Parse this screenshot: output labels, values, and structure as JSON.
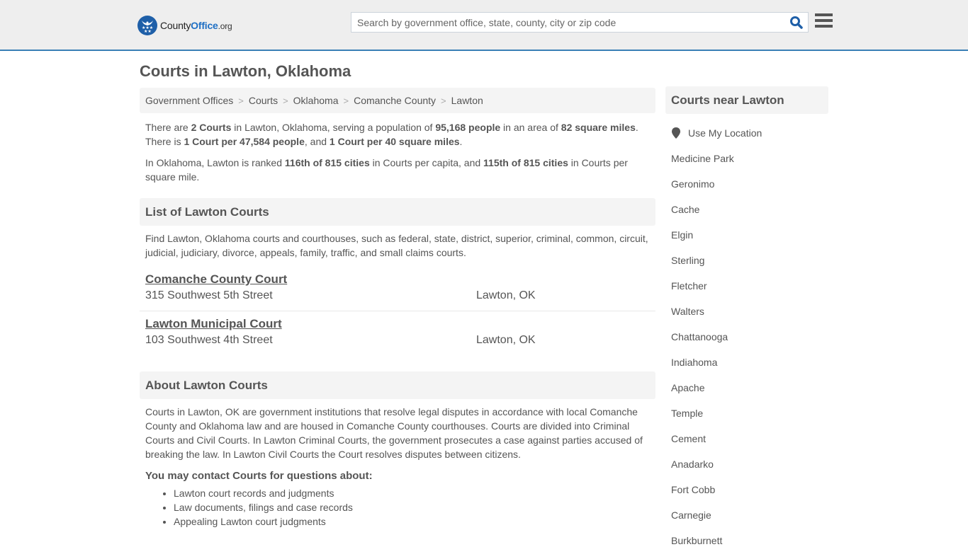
{
  "header": {
    "logo": {
      "name_part1": "County",
      "name_part2": "Office",
      "tld": ".org"
    },
    "search": {
      "placeholder": "Search by government office, state, county, city or zip code",
      "value": ""
    },
    "icons": {
      "search": "search-icon",
      "menu": "hamburger-menu-icon",
      "logo": "eagle-stars-badge-icon"
    },
    "accent_color": "#3a7fb5"
  },
  "page_title": "Courts in Lawton, Oklahoma",
  "breadcrumb": [
    "Government Offices",
    "Courts",
    "Oklahoma",
    "Comanche County",
    "Lawton"
  ],
  "intro": {
    "p1": {
      "t1": "There are ",
      "b1": "2 Courts",
      "t2": " in Lawton, Oklahoma, serving a population of ",
      "b2": "95,168 people",
      "t3": " in an area of ",
      "b3": "82 square miles",
      "t4": ". There is ",
      "b4": "1 Court per 47,584 people",
      "t5": ", and ",
      "b5": "1 Court per 40 square miles",
      "t6": "."
    },
    "p2": {
      "t1": "In Oklahoma, Lawton is ranked ",
      "b1": "116th of 815 cities",
      "t2": " in Courts per capita, and ",
      "b2": "115th of 815 cities",
      "t3": " in Courts per square mile."
    }
  },
  "list_section": {
    "title": "List of Lawton Courts",
    "description": "Find Lawton, Oklahoma courts and courthouses, such as federal, state, district, superior, criminal, common, circuit, judicial, judiciary, divorce, appeals, family, traffic, and small claims courts.",
    "courts": [
      {
        "name": "Comanche County Court",
        "address": "315 Southwest 5th Street",
        "city": "Lawton, OK"
      },
      {
        "name": "Lawton Municipal Court",
        "address": "103 Southwest 4th Street",
        "city": "Lawton, OK"
      }
    ]
  },
  "about_section": {
    "title": "About Lawton Courts",
    "text": "Courts in Lawton, OK are government institutions that resolve legal disputes in accordance with local Comanche County and Oklahoma law and are housed in Comanche County courthouses. Courts are divided into Criminal Courts and Civil Courts. In Lawton Criminal Courts, the government prosecutes a case against parties accused of breaking the law. In Lawton Civil Courts the Court resolves disputes between citizens.",
    "contact_heading": "You may contact Courts for questions about:",
    "contact_items": [
      "Lawton court records and judgments",
      "Law documents, filings and case records",
      "Appealing Lawton court judgments"
    ]
  },
  "sidebar": {
    "title": "Courts near Lawton",
    "use_location": "Use My Location",
    "nearby": [
      "Medicine Park",
      "Geronimo",
      "Cache",
      "Elgin",
      "Sterling",
      "Fletcher",
      "Walters",
      "Chattanooga",
      "Indiahoma",
      "Apache",
      "Temple",
      "Cement",
      "Anadarko",
      "Fort Cobb",
      "Carnegie",
      "Burkburnett"
    ]
  }
}
